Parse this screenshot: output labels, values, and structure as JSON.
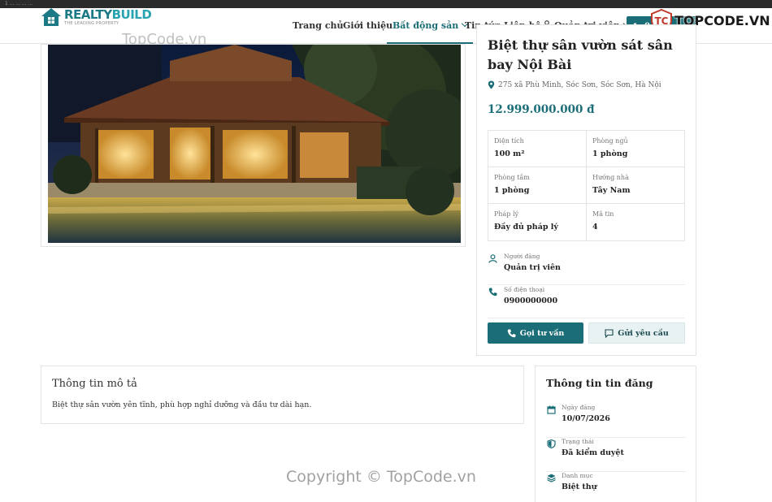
{
  "browser": {
    "strip_text": "1 ... ... ... ..."
  },
  "logo": {
    "main_prefix": "REALTY",
    "main_suffix": "BUILD",
    "tagline": "THE LEADING PROPERTY"
  },
  "nav": {
    "items": [
      {
        "label": "Trang chủ"
      },
      {
        "label": "Giới thiệu"
      },
      {
        "label": "Bất động sản"
      },
      {
        "label": "Tin tức"
      },
      {
        "label": "Liên hệ"
      },
      {
        "label": "Quản trị viên"
      }
    ],
    "active_index": 2,
    "phone_label": "0..."
  },
  "watermarks": {
    "top": "TopCode.vn",
    "bottom": "Copyright © TopCode.vn",
    "badge": "TOPCODE.VN"
  },
  "property": {
    "title": "Biệt thự sân vườn sát sân bay Nội Bài",
    "address": "275 xã Phù Minh, Sóc Sơn, Sóc Sơn, Hà Nội",
    "price": "12.999.000.000 đ",
    "specs": [
      {
        "key": "Diện tích",
        "value": "100 m²"
      },
      {
        "key": "Phòng ngủ",
        "value": "1 phòng"
      },
      {
        "key": "Phòng tắm",
        "value": "1 phòng"
      },
      {
        "key": "Hướng nhà",
        "value": "Tây Nam"
      },
      {
        "key": "Pháp lý",
        "value": "Đầy đủ pháp lý"
      },
      {
        "key": "Mã tin",
        "value": "4"
      }
    ],
    "poster_label": "Người đăng",
    "poster_value": "Quản trị viên",
    "phone_label": "Số điện thoại",
    "phone_value": "0900000000",
    "call_button": "Gọi tư vấn",
    "request_button": "Gửi yêu cầu"
  },
  "description": {
    "title": "Thông tin mô tả",
    "text": "Biệt thự sân vườn yên tĩnh, phù hợp nghỉ dưỡng và đầu tư dài hạn."
  },
  "listing": {
    "title": "Thông tin tin đăng",
    "items": [
      {
        "key": "Ngày đăng",
        "value": "10/07/2026",
        "icon": "calendar-icon"
      },
      {
        "key": "Trạng thái",
        "value": "Đã kiểm duyệt",
        "icon": "shield-icon"
      },
      {
        "key": "Danh mục",
        "value": "Biệt thự",
        "icon": "layers-icon"
      }
    ]
  },
  "colors": {
    "primary": "#1b6e77",
    "logo": "#1c7a86"
  }
}
